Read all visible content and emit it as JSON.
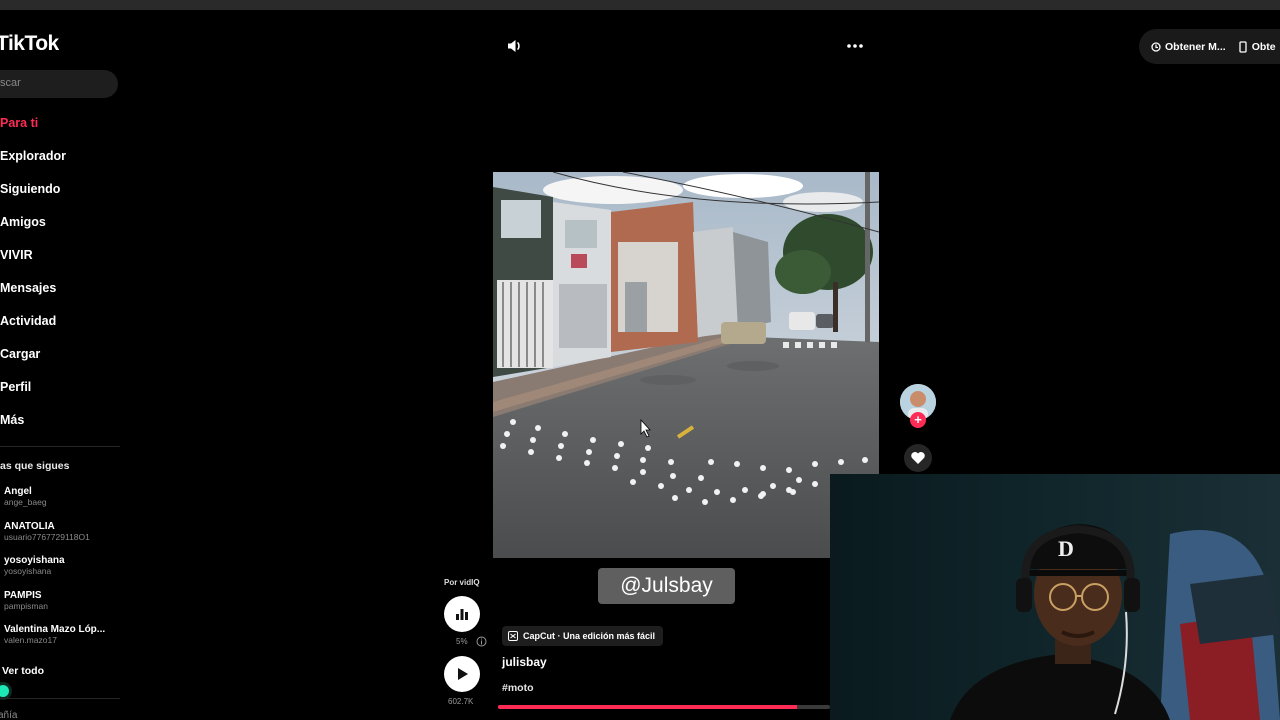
{
  "app": {
    "logo_text": "TikTok"
  },
  "search": {
    "placeholder": "scar"
  },
  "nav": {
    "items": [
      {
        "label": "Para ti",
        "active": true
      },
      {
        "label": "Explorador"
      },
      {
        "label": "Siguiendo"
      },
      {
        "label": "Amigos"
      },
      {
        "label": "VIVIR"
      },
      {
        "label": "Mensajes"
      },
      {
        "label": "Actividad"
      },
      {
        "label": "Cargar"
      },
      {
        "label": "Perfil"
      },
      {
        "label": "Más"
      }
    ]
  },
  "following": {
    "title": "as que sigues",
    "accounts": [
      {
        "name": "Ángel",
        "handle": "ange_baeg"
      },
      {
        "name": "ANATOLIA",
        "handle": "usuario7767729118O1"
      },
      {
        "name": "yosoyishana",
        "handle": "yosoyishana"
      },
      {
        "name": "PAMPIS",
        "handle": "pampisman"
      },
      {
        "name": "Valentina Mazo Lóp...",
        "handle": "valen.mazo17"
      }
    ],
    "see_all": "Ver todo"
  },
  "sidebar_footer": {
    "cut_label": "añía"
  },
  "top_right": {
    "btn1_label": "Obtener M...",
    "btn2_label": "Obte"
  },
  "player": {
    "by_label": "Por vidIQ",
    "percent_label": "5%",
    "views_label": "602.7K",
    "watermark": "@Julsbay",
    "capcut_label": "CapCut · Una edición más fácil",
    "author": "julisbay",
    "hashtag": "#moto",
    "progress": 0.9
  },
  "colors": {
    "accent": "#fe2c55",
    "background": "#000000",
    "surface": "#1e1e1e"
  },
  "icons": {
    "volume": "volume-icon",
    "more": "more-dots-icon",
    "like": "heart-icon",
    "play": "play-icon",
    "stats": "bar-chart-icon"
  }
}
